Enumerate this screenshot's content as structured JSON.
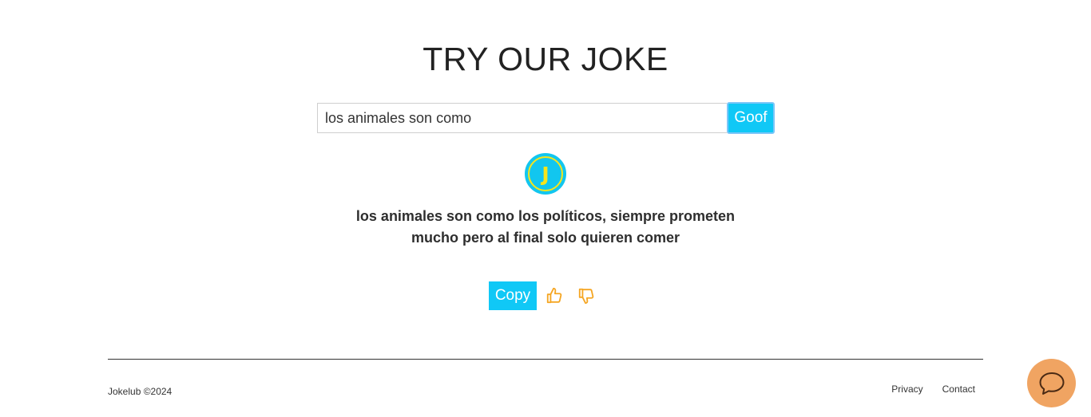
{
  "header": {
    "title": "TRY OUR JOKE"
  },
  "search": {
    "value": "los animales son como",
    "button_label": "Goof"
  },
  "avatar": {
    "letter": "J"
  },
  "joke": {
    "line1": "los animales son como los políticos, siempre prometen",
    "line2": "mucho pero al final solo quieren comer"
  },
  "actions": {
    "copy_label": "Copy",
    "like_icon": "thumbs-up-icon",
    "dislike_icon": "thumbs-down-icon"
  },
  "footer": {
    "copyright": "Jokelub ©2024",
    "links": [
      "Privacy",
      "Contact"
    ]
  },
  "chat": {
    "icon": "chat-bubble-icon"
  },
  "colors": {
    "accent": "#10c8f6",
    "icon_orange": "#f5a623",
    "chat_bg": "#f0a462"
  }
}
